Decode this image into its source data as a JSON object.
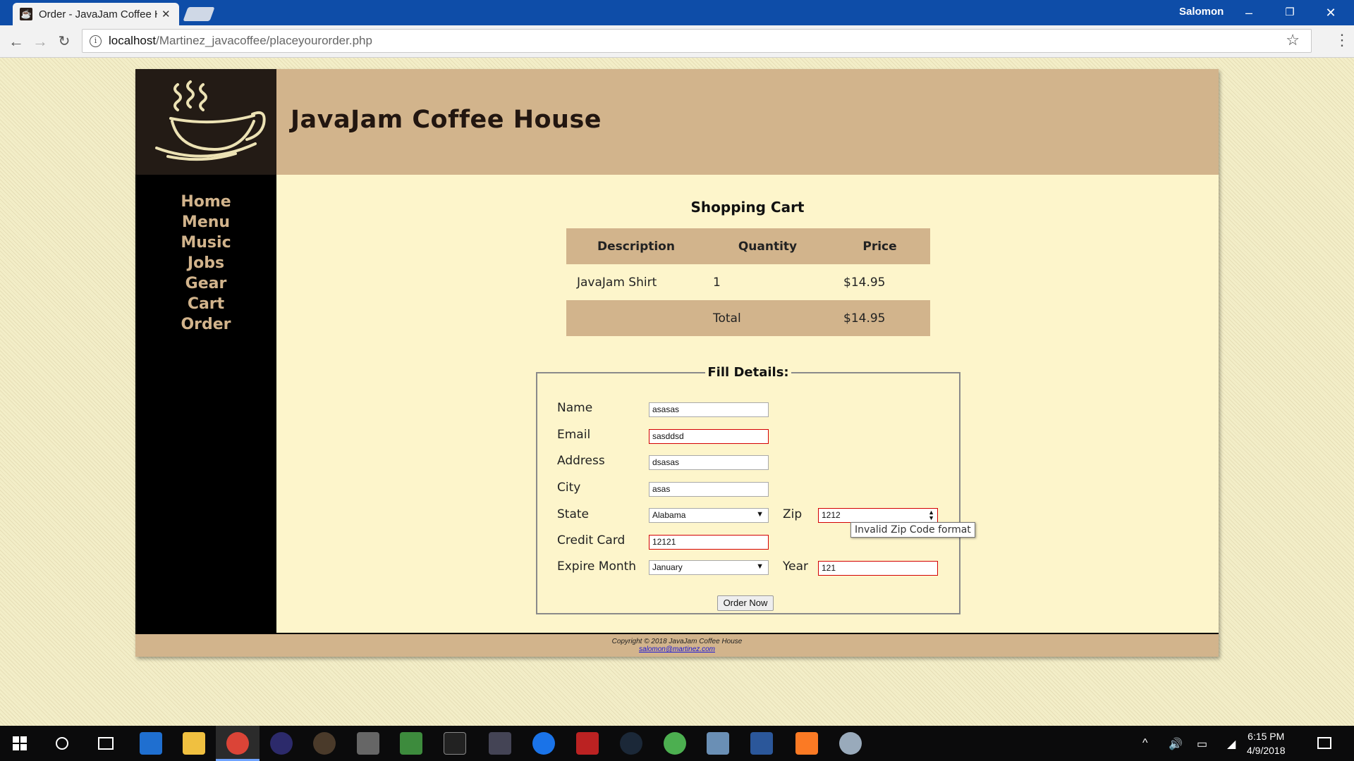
{
  "browser": {
    "tab_title": "Order - JavaJam Coffee H",
    "url_host": "localhost",
    "url_path": "/Martinez_javacoffee/placeyourorder.php",
    "user": "Salomon"
  },
  "site": {
    "title": "JavaJam Coffee House",
    "nav": [
      "Home",
      "Menu",
      "Music",
      "Jobs",
      "Gear",
      "Cart",
      "Order"
    ]
  },
  "cart": {
    "title": "Shopping Cart",
    "headers": [
      "Description",
      "Quantity",
      "Price"
    ],
    "item": {
      "description": "JavaJam Shirt",
      "quantity": "1",
      "price": "$14.95"
    },
    "total_label": "Total",
    "total_price": "$14.95"
  },
  "form": {
    "legend": "Fill Details:",
    "name_label": "Name",
    "name_value": "asasas",
    "email_label": "Email",
    "email_value": "sasddsd",
    "address_label": "Address",
    "address_value": "dsasas",
    "city_label": "City",
    "city_value": "asas",
    "state_label": "State",
    "state_value": "Alabama",
    "zip_label": "Zip",
    "zip_value": "1212",
    "zip_tooltip": "Invalid Zip Code format",
    "card_label": "Credit Card",
    "card_value": "12121",
    "month_label": "Expire Month",
    "month_value": "January",
    "year_label": "Year",
    "year_value": "121",
    "submit_label": "Order Now"
  },
  "footer": {
    "copyright": "Copyright © 2018 JavaJam Coffee House",
    "email": "salomon@martinez.com"
  },
  "taskbar": {
    "time": "6:15 PM",
    "date": "4/9/2018"
  },
  "colors": {
    "header_tan": "#d2b48c",
    "content_cream": "#fdf5cb",
    "sidebar_black": "#000000",
    "invalid_border": "#d40000",
    "titlebar_blue": "#0e4da8"
  }
}
